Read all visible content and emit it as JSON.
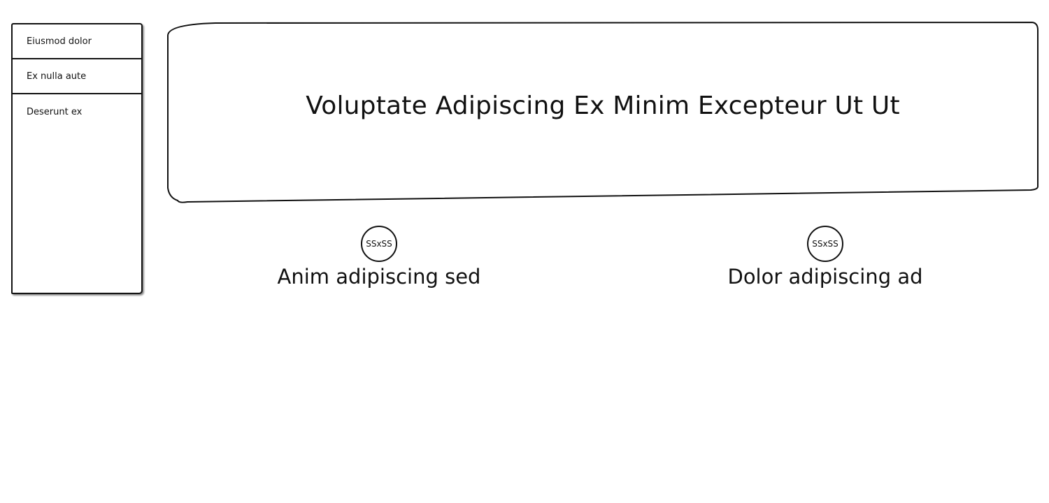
{
  "sidebar": {
    "items": [
      {
        "label": "Eiusmod dolor"
      },
      {
        "label": "Ex nulla aute"
      },
      {
        "label": "Deserunt ex"
      }
    ]
  },
  "header": {
    "title": "Voluptate Adipiscing Ex Minim Excepteur Ut Ut"
  },
  "cards": [
    {
      "avatar_text": "SSxSS",
      "name": "Anim adipiscing sed"
    },
    {
      "avatar_text": "SSxSS",
      "name": "Dolor adipiscing ad"
    }
  ]
}
